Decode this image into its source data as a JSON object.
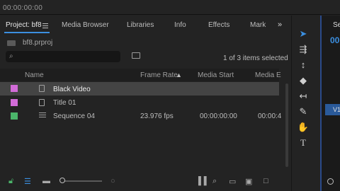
{
  "timecode": "00:00:00:00",
  "tabs": [
    {
      "label": "Project: bf8"
    },
    {
      "label": "Media Browser"
    },
    {
      "label": "Libraries"
    },
    {
      "label": "Info"
    },
    {
      "label": "Effects"
    },
    {
      "label": "Mark"
    }
  ],
  "overflow_chevron": "»",
  "project_file": "bf8.prproj",
  "search": {
    "placeholder": "",
    "value": ""
  },
  "selection_count": "1 of 3 items selected",
  "columns": {
    "name": "Name",
    "frame_rate": "Frame Rate",
    "media_start": "Media Start",
    "media_end": "Media E"
  },
  "rows": [
    {
      "name": "Black Video",
      "frame_rate": "",
      "media_start": "",
      "media_end": "",
      "color": "#d26cd8",
      "icon": "file-icon",
      "selected": true
    },
    {
      "name": "Title 01",
      "frame_rate": "",
      "media_start": "",
      "media_end": "",
      "color": "#d26cd8",
      "icon": "file-icon",
      "selected": false
    },
    {
      "name": "Sequence 04",
      "frame_rate": "23.976 fps",
      "media_start": "00:00:00:00",
      "media_end": "00:00:4",
      "color": "#4bb56a",
      "icon": "sequence-icon",
      "selected": false
    }
  ],
  "right_panel": {
    "tab": "Se",
    "timecode": "00",
    "track": "V1"
  },
  "tools": [
    "selection-tool-icon",
    "track-select-tool-icon",
    "ripple-edit-tool-icon",
    "razor-tool-icon",
    "slip-tool-icon",
    "pen-tool-icon",
    "hand-tool-icon",
    "type-tool-icon"
  ],
  "accent": "#3b8fe0"
}
